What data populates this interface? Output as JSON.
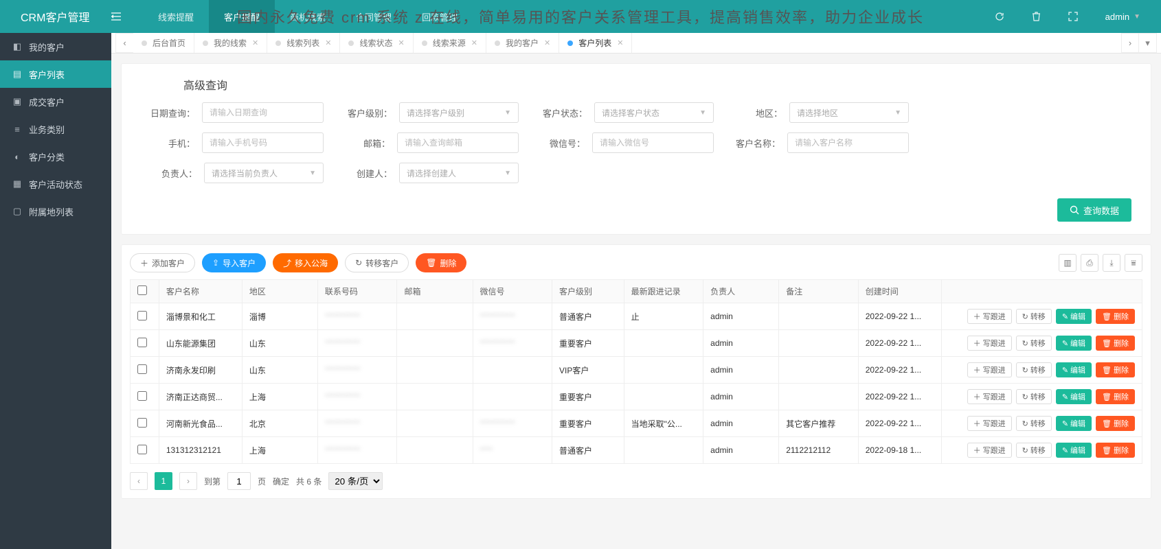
{
  "overlay_title": "国内永久免费 crm 系统 z 在线，简单易用的客户关系管理工具，提高销售效率，助力企业成长",
  "brand": "CRM客户管理",
  "topnav": [
    {
      "label": "线索提醒",
      "active": false
    },
    {
      "label": "客户提醒",
      "active": true
    },
    {
      "label": "商机线索",
      "active": false
    },
    {
      "label": "合同管理",
      "active": false
    },
    {
      "label": "回款管理",
      "active": false
    }
  ],
  "user": {
    "name": "admin"
  },
  "sidebar": [
    {
      "icon": "user-icon",
      "label": "我的客户",
      "active": false
    },
    {
      "icon": "list-icon",
      "label": "客户列表",
      "active": true
    },
    {
      "icon": "deal-icon",
      "label": "成交客户",
      "active": false
    },
    {
      "icon": "category-icon",
      "label": "业务类别",
      "active": false
    },
    {
      "icon": "group-icon",
      "label": "客户分类",
      "active": false
    },
    {
      "icon": "activity-icon",
      "label": "客户活动状态",
      "active": false
    },
    {
      "icon": "location-icon",
      "label": "附属地列表",
      "active": false
    }
  ],
  "tabs": [
    {
      "label": "后台首页",
      "active": false,
      "closable": false
    },
    {
      "label": "我的线索",
      "active": false,
      "closable": true
    },
    {
      "label": "线索列表",
      "active": false,
      "closable": true
    },
    {
      "label": "线索状态",
      "active": false,
      "closable": true
    },
    {
      "label": "线索来源",
      "active": false,
      "closable": true
    },
    {
      "label": "我的客户",
      "active": false,
      "closable": true
    },
    {
      "label": "客户列表",
      "active": true,
      "closable": true
    }
  ],
  "search": {
    "title": "高级查询",
    "fields": {
      "date": {
        "label": "日期查询：",
        "placeholder": "请输入日期查询"
      },
      "level": {
        "label": "客户级别：",
        "placeholder": "请选择客户级别"
      },
      "status": {
        "label": "客户状态：",
        "placeholder": "请选择客户状态"
      },
      "area": {
        "label": "地区：",
        "placeholder": "请选择地区"
      },
      "phone": {
        "label": "手机：",
        "placeholder": "请输入手机号码"
      },
      "email": {
        "label": "邮箱：",
        "placeholder": "请输入查询邮箱"
      },
      "wechat": {
        "label": "微信号：",
        "placeholder": "请输入微信号"
      },
      "name": {
        "label": "客户名称：",
        "placeholder": "请输入客户名称"
      },
      "owner": {
        "label": "负责人：",
        "placeholder": "请选择当前负责人"
      },
      "creator": {
        "label": "创建人：",
        "placeholder": "请选择创建人"
      }
    },
    "query_btn": "查询数据"
  },
  "toolbar": {
    "add": "添加客户",
    "import": "导入客户",
    "to_public": "移入公海",
    "transfer": "转移客户",
    "delete": "删除"
  },
  "table": {
    "headers": {
      "name": "客户名称",
      "area": "地区",
      "phone": "联系号码",
      "email": "邮箱",
      "wechat": "微信号",
      "level": "客户级别",
      "follow": "最新跟进记录",
      "owner": "负责人",
      "remark": "备注",
      "time": "创建时间"
    },
    "rows": [
      {
        "name": "淄博景和化工",
        "area": "淄博",
        "phone": "***********",
        "email": "",
        "wechat": "***********",
        "level": "普通客户",
        "follow": "止",
        "owner": "admin",
        "remark": "",
        "time": "2022-09-22 1..."
      },
      {
        "name": "山东能源集团",
        "area": "山东",
        "phone": "***********",
        "email": "",
        "wechat": "***********",
        "level": "重要客户",
        "follow": "",
        "owner": "admin",
        "remark": "",
        "time": "2022-09-22 1..."
      },
      {
        "name": "济南永发印刷",
        "area": "山东",
        "phone": "***********",
        "email": "",
        "wechat": "",
        "level": "VIP客户",
        "follow": "",
        "owner": "admin",
        "remark": "",
        "time": "2022-09-22 1..."
      },
      {
        "name": "济南正达商贸...",
        "area": "上海",
        "phone": "***********",
        "email": "",
        "wechat": "",
        "level": "重要客户",
        "follow": "",
        "owner": "admin",
        "remark": "",
        "time": "2022-09-22 1..."
      },
      {
        "name": "河南新光食品...",
        "area": "北京",
        "phone": "***********",
        "email": "",
        "wechat": "***********",
        "level": "重要客户",
        "follow": "当地采取\"公...",
        "owner": "admin",
        "remark": "其它客户推荐",
        "time": "2022-09-22 1..."
      },
      {
        "name": "131312312121",
        "area": "上海",
        "phone": "***********",
        "email": "",
        "wechat": "****",
        "level": "普通客户",
        "follow": "",
        "owner": "admin",
        "remark": "2112212112",
        "time": "2022-09-18 1..."
      }
    ],
    "ops": {
      "followup": "写跟进",
      "transfer": "转移",
      "edit": "编辑",
      "delete": "删除"
    }
  },
  "pager": {
    "current": "1",
    "goto_label": "到第",
    "page_label": "页",
    "confirm": "确定",
    "total": "共 6 条",
    "size": "20 条/页"
  }
}
